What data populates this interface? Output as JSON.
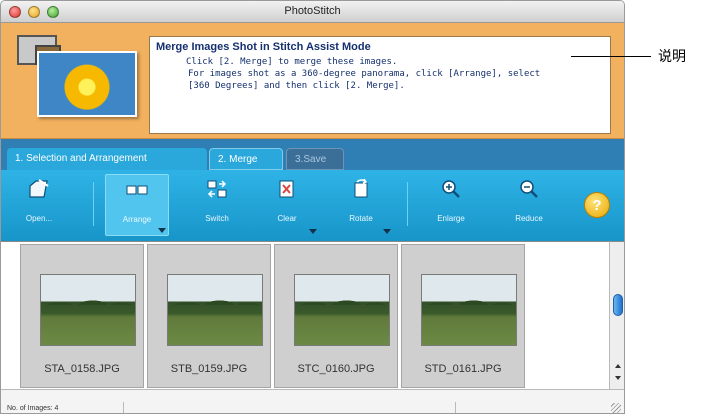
{
  "window": {
    "title": "PhotoStitch"
  },
  "message": {
    "title": "Merge Images Shot in Stitch Assist Mode",
    "line1": "Click [2. Merge] to merge these images.",
    "line2": "For images shot as a 360-degree panorama, click [Arrange], select",
    "line3": "[360 Degrees] and then click [2. Merge]."
  },
  "tabs": [
    {
      "label": "1. Selection and Arrangement",
      "state": "active"
    },
    {
      "label": "2. Merge",
      "state": "enabled"
    },
    {
      "label": "3.Save",
      "state": "disabled"
    }
  ],
  "toolbar": {
    "open": "Open...",
    "arrange": "Arrange",
    "switch": "Switch",
    "clear": "Clear",
    "rotate": "Rotate",
    "enlarge": "Enlarge",
    "reduce": "Reduce",
    "help": "?"
  },
  "images": [
    {
      "name": "STA_0158.JPG"
    },
    {
      "name": "STB_0159.JPG"
    },
    {
      "name": "STC_0160.JPG"
    },
    {
      "name": "STD_0161.JPG"
    }
  ],
  "status": {
    "count_text": "No. of Images: 4"
  },
  "annotation": {
    "label": "说明"
  },
  "colors": {
    "banner": "#f2b15e",
    "tab_bar": "#2f7fb5",
    "toolbar": "#1fa3d8",
    "message_text": "#15306e"
  }
}
